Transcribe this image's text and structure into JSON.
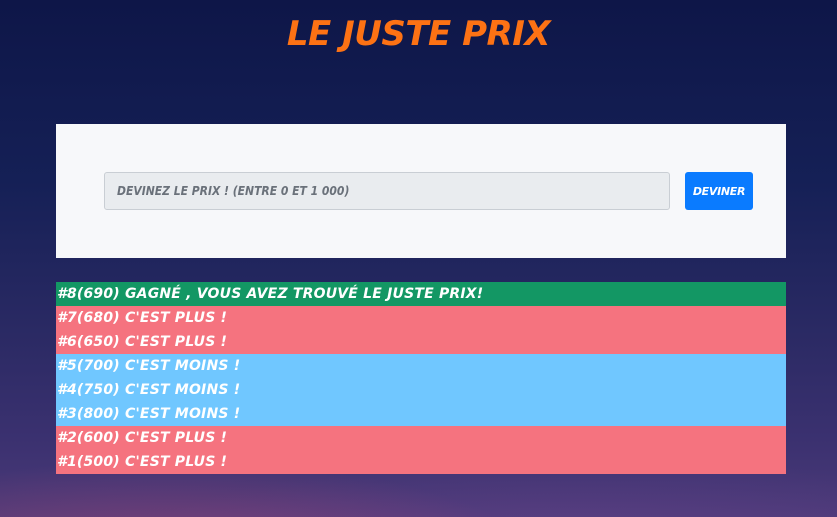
{
  "app": {
    "title": "LE JUSTE PRIX"
  },
  "form": {
    "input_value": "",
    "input_placeholder": "Devinez le prix ! (Entre 0 et 1 000)",
    "button_label": "Deviner"
  },
  "history": [
    {
      "text": "#8(690) Gagné , vous avez trouvé le juste prix!",
      "status": "win"
    },
    {
      "text": "#7(680) C'est plus !",
      "status": "plus"
    },
    {
      "text": "#6(650) C'est plus !",
      "status": "plus"
    },
    {
      "text": "#5(700) C'est moins !",
      "status": "moins"
    },
    {
      "text": "#4(750) C'est moins !",
      "status": "moins"
    },
    {
      "text": "#3(800) C'est moins !",
      "status": "moins"
    },
    {
      "text": "#2(600) C'est plus !",
      "status": "plus"
    },
    {
      "text": "#1(500) C'est plus !",
      "status": "plus"
    }
  ],
  "colors": {
    "title": "#fd7214",
    "button": "#0a7bff",
    "win": "#139764",
    "plus": "#f5737f",
    "moins": "#70c7ff"
  }
}
